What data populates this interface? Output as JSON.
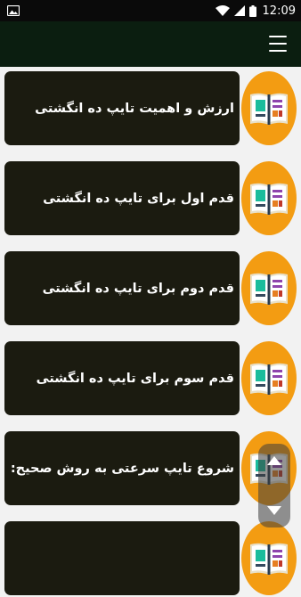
{
  "status_bar": {
    "time": "12:09",
    "icons": [
      "image-icon",
      "wifi-icon",
      "signal-icon",
      "battery-icon"
    ]
  },
  "app_bar": {
    "menu_icon": "hamburger-menu-icon",
    "background": "#0b1e10"
  },
  "colors": {
    "card": "#1b1b10",
    "avatar": "#f39c12",
    "card_text": "#ffffff"
  },
  "items": [
    {
      "label": "ارزش و اهمیت تایپ ده انگشتی",
      "icon": "book-icon"
    },
    {
      "label": "قدم اول برای تایپ ده انگشتی",
      "icon": "book-icon"
    },
    {
      "label": "قدم دوم برای تایپ ده انگشتی",
      "icon": "book-icon"
    },
    {
      "label": "قدم سوم برای تایپ ده انگشتی",
      "icon": "book-icon"
    },
    {
      "label": "شروع تایپ سرعتی به روش صحیح:",
      "icon": "book-icon"
    },
    {
      "label": "",
      "icon": "book-icon"
    }
  ]
}
